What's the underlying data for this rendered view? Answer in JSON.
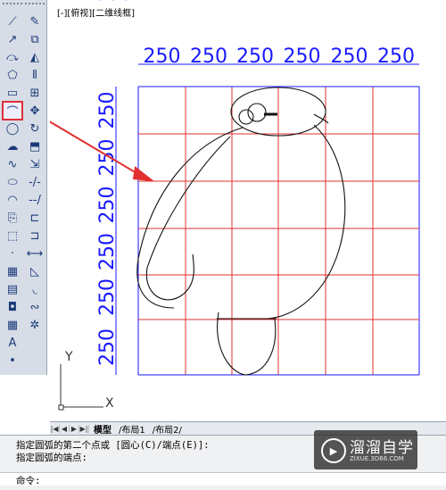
{
  "viewport": {
    "label": "[-][俯视][二维线框]"
  },
  "toolbar_left": [
    {
      "icon": "line-icon",
      "glyph": "⟋"
    },
    {
      "icon": "construction-line-icon",
      "glyph": "↗"
    },
    {
      "icon": "polyline-icon",
      "glyph": "⤼"
    },
    {
      "icon": "polygon-icon",
      "glyph": "⬠"
    },
    {
      "icon": "rectangle-icon",
      "glyph": "▭"
    },
    {
      "icon": "arc-icon",
      "glyph": "⌒",
      "active": true
    },
    {
      "icon": "circle-icon",
      "glyph": "◯"
    },
    {
      "icon": "revision-cloud-icon",
      "glyph": "☁"
    },
    {
      "icon": "spline-icon",
      "glyph": "∿"
    },
    {
      "icon": "ellipse-icon",
      "glyph": "⬭"
    },
    {
      "icon": "ellipse-arc-icon",
      "glyph": "◠"
    },
    {
      "icon": "insert-block-icon",
      "glyph": "⎘"
    },
    {
      "icon": "make-block-icon",
      "glyph": "⬚"
    },
    {
      "icon": "point-icon",
      "glyph": "·"
    },
    {
      "icon": "hatch-icon",
      "glyph": "▦"
    },
    {
      "icon": "gradient-icon",
      "glyph": "▤"
    },
    {
      "icon": "region-icon",
      "glyph": "◘"
    },
    {
      "icon": "table-icon",
      "glyph": "▦"
    },
    {
      "icon": "multiline-text-icon",
      "glyph": "A"
    },
    {
      "icon": "add-selected-icon",
      "glyph": "•"
    }
  ],
  "toolbar_right": [
    {
      "icon": "erase-icon",
      "glyph": "✎"
    },
    {
      "icon": "copy-icon",
      "glyph": "⧉"
    },
    {
      "icon": "mirror-icon",
      "glyph": "◭"
    },
    {
      "icon": "offset-icon",
      "glyph": "⫴"
    },
    {
      "icon": "array-icon",
      "glyph": "⊞"
    },
    {
      "icon": "move-icon",
      "glyph": "✥"
    },
    {
      "icon": "rotate-icon",
      "glyph": "↻"
    },
    {
      "icon": "scale-icon",
      "glyph": "⬒"
    },
    {
      "icon": "stretch-icon",
      "glyph": "⇲"
    },
    {
      "icon": "trim-icon",
      "glyph": "-/-"
    },
    {
      "icon": "extend-icon",
      "glyph": "--/"
    },
    {
      "icon": "break-at-point-icon",
      "glyph": "⊏"
    },
    {
      "icon": "break-icon",
      "glyph": "⊐"
    },
    {
      "icon": "join-icon",
      "glyph": "⟷"
    },
    {
      "icon": "chamfer-icon",
      "glyph": "◺"
    },
    {
      "icon": "fillet-icon",
      "glyph": "◟"
    },
    {
      "icon": "blend-curves-icon",
      "glyph": "∾"
    },
    {
      "icon": "explode-icon",
      "glyph": "✲"
    }
  ],
  "grid": {
    "top_labels": [
      "250",
      "250",
      "250",
      "250",
      "250",
      "250"
    ],
    "side_labels": [
      "250",
      "250",
      "250",
      "250",
      "250",
      "250",
      "300"
    ],
    "label_color": "#1a1aff",
    "line_color": "#e23030"
  },
  "ucs": {
    "x_label": "X",
    "y_label": "Y"
  },
  "tabs": {
    "model": "模型",
    "layout1": "布局1",
    "layout2": "布局2"
  },
  "command": {
    "line1": "指定圆弧的第二个点或 [圆心(C)/端点(E)]:",
    "line2": "指定圆弧的端点:",
    "prompt": "命令:"
  },
  "watermark": {
    "title": "溜溜自学",
    "subtitle": "ZIXUE.3D66.COM"
  }
}
